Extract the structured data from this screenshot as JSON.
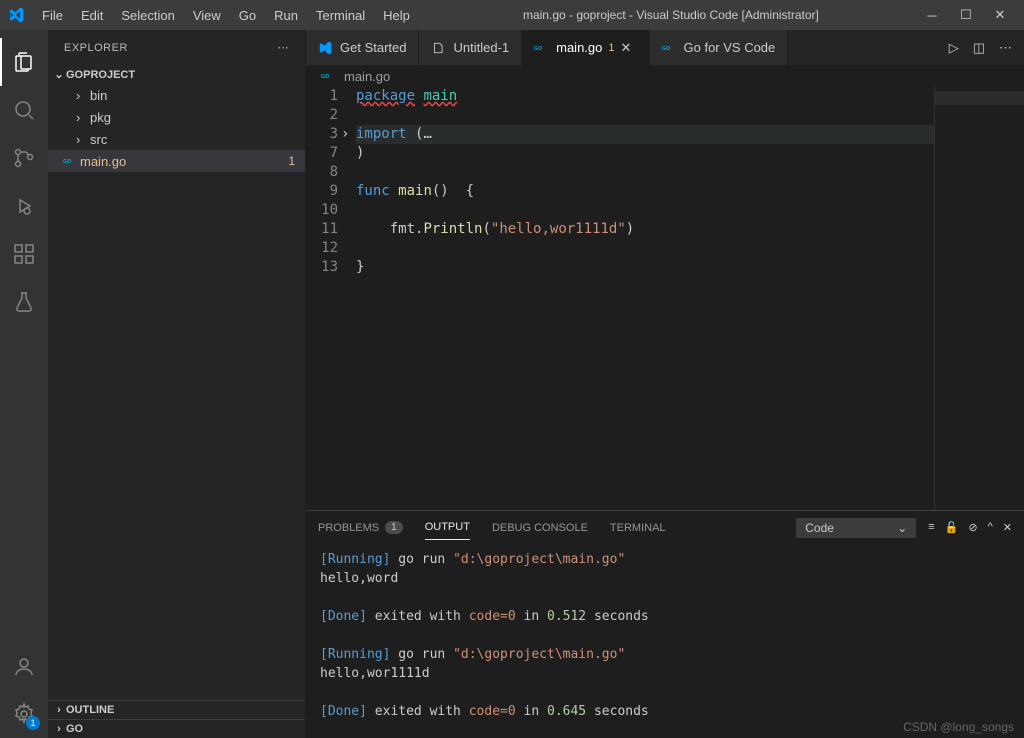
{
  "window": {
    "title": "main.go - goproject - Visual Studio Code [Administrator]"
  },
  "menubar": [
    "File",
    "Edit",
    "Selection",
    "View",
    "Go",
    "Run",
    "Terminal",
    "Help"
  ],
  "sidebar": {
    "title": "EXPLORER",
    "project": "GOPROJECT",
    "root_items": [
      {
        "chev": "›",
        "label": "bin"
      },
      {
        "chev": "›",
        "label": "pkg"
      },
      {
        "chev": "›",
        "label": "src"
      }
    ],
    "file": {
      "label": "main.go",
      "badge": "1"
    },
    "outline": "OUTLINE",
    "go": "GO"
  },
  "tabs": [
    {
      "label": "Get Started",
      "type": "vscode"
    },
    {
      "label": "Untitled-1",
      "type": "text"
    },
    {
      "label": "main.go",
      "type": "go",
      "mod": "1",
      "active": true,
      "close": true
    },
    {
      "label": "Go for VS Code",
      "type": "go"
    }
  ],
  "breadcrumb": {
    "icon": "go",
    "text": "main.go"
  },
  "editor": {
    "lines": [
      {
        "n": "1",
        "tokens": [
          {
            "t": "package",
            "c": "kw sqg"
          },
          {
            "t": " "
          },
          {
            "t": "main",
            "c": "pkg sqg"
          }
        ]
      },
      {
        "n": "2",
        "tokens": []
      },
      {
        "n": "3",
        "fold": "›",
        "hl": true,
        "tokens": [
          {
            "t": "import",
            "c": "kw"
          },
          {
            "t": " ("
          },
          {
            "t": "…",
            "c": "op"
          }
        ]
      },
      {
        "n": "7",
        "tokens": [
          {
            "t": ")"
          }
        ]
      },
      {
        "n": "8",
        "tokens": []
      },
      {
        "n": "9",
        "tokens": [
          {
            "t": "func",
            "c": "kw"
          },
          {
            "t": " "
          },
          {
            "t": "main",
            "c": "fn"
          },
          {
            "t": "()  {"
          }
        ]
      },
      {
        "n": "10",
        "tokens": []
      },
      {
        "n": "11",
        "tokens": [
          {
            "t": "    fmt."
          },
          {
            "t": "Println",
            "c": "fn"
          },
          {
            "t": "("
          },
          {
            "t": "\"hello,wor1111d\"",
            "c": "str"
          },
          {
            "t": ")"
          }
        ]
      },
      {
        "n": "12",
        "tokens": []
      },
      {
        "n": "13",
        "tokens": [
          {
            "t": "}"
          }
        ]
      }
    ]
  },
  "panel": {
    "tabs": [
      {
        "label": "PROBLEMS",
        "badge": "1"
      },
      {
        "label": "OUTPUT",
        "active": true
      },
      {
        "label": "DEBUG CONSOLE"
      },
      {
        "label": "TERMINAL"
      }
    ],
    "select": "Code",
    "output": [
      [
        {
          "t": "[Running]",
          "c": "out-tag"
        },
        {
          "t": " go run "
        },
        {
          "t": "\"d:\\goproject\\main.go\"",
          "c": "out-cmd"
        }
      ],
      [
        {
          "t": "hello,word"
        }
      ],
      [],
      [
        {
          "t": "[Done]",
          "c": "out-tag"
        },
        {
          "t": " exited with "
        },
        {
          "t": "code=0",
          "c": "out-cmd"
        },
        {
          "t": " in "
        },
        {
          "t": "0.512",
          "c": "out-num"
        },
        {
          "t": " seconds"
        }
      ],
      [],
      [
        {
          "t": "[Running]",
          "c": "out-tag"
        },
        {
          "t": " go run "
        },
        {
          "t": "\"d:\\goproject\\main.go\"",
          "c": "out-cmd"
        }
      ],
      [
        {
          "t": "hello,wor1111d"
        }
      ],
      [],
      [
        {
          "t": "[Done]",
          "c": "out-tag"
        },
        {
          "t": " exited with "
        },
        {
          "t": "code=0",
          "c": "out-cmd"
        },
        {
          "t": " in "
        },
        {
          "t": "0.645",
          "c": "out-num"
        },
        {
          "t": " seconds"
        }
      ]
    ]
  },
  "watermark": "CSDN @long_songs",
  "settings_badge": "1"
}
